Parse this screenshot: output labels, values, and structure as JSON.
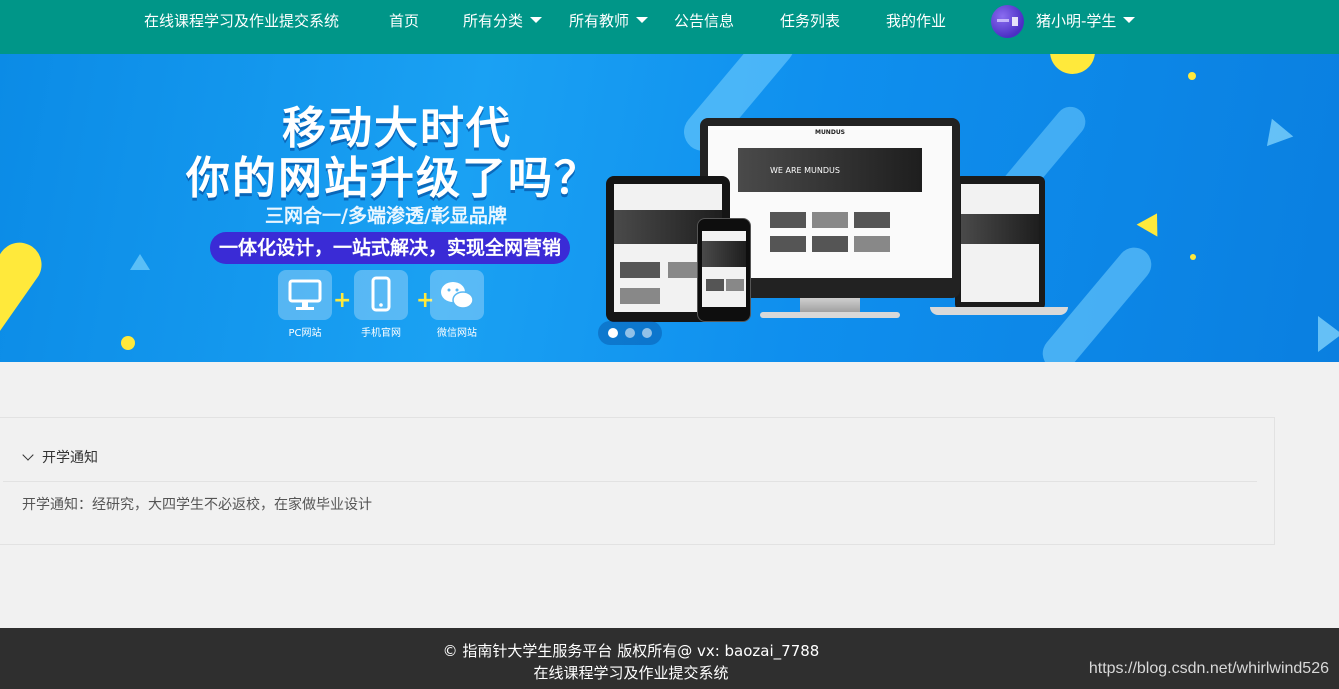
{
  "nav": {
    "site_title": "在线课程学习及作业提交系统",
    "items": [
      {
        "label": "首页"
      },
      {
        "label": "所有分类"
      },
      {
        "label": "所有教师"
      },
      {
        "label": "公告信息"
      },
      {
        "label": "任务列表"
      },
      {
        "label": "我的作业"
      }
    ],
    "user": {
      "name": "猪小明-学生",
      "avatar_icon": "user-avatar-icon"
    },
    "colors": {
      "bar": "#009688",
      "text": "#ffffff"
    }
  },
  "banner": {
    "headline_line1": "移动大时代",
    "headline_line2": "你的网站升级了吗？",
    "tagline": "三网合一/多端渗透/彰显品牌",
    "pill_text": "一体化设计，一站式解决，实现全网营销",
    "features": [
      {
        "label": "PC网站",
        "icon": "monitor-icon"
      },
      {
        "label": "手机官网",
        "icon": "mobile-icon"
      },
      {
        "label": "微信网站",
        "icon": "wechat-icon"
      }
    ],
    "mockup": {
      "brand": "MUNDUS",
      "hero_text": "WE ARE MUNDUS"
    },
    "slider": {
      "count": 3,
      "active": 0
    },
    "colors": {
      "bg": "#0f8fee",
      "accent": "#ffe93b",
      "pill": "#3a2bd6"
    }
  },
  "notice": {
    "title": "开学通知",
    "body": "开学通知：经研究，大四学生不必返校，在家做毕业设计"
  },
  "footer": {
    "line1": "© 指南针大学生服务平台 版权所有@ vx: baozai_7788",
    "line2": "在线课程学习及作业提交系统",
    "watermark": "https://blog.csdn.net/whirlwind526",
    "colors": {
      "bg": "#2f2f2f"
    }
  }
}
